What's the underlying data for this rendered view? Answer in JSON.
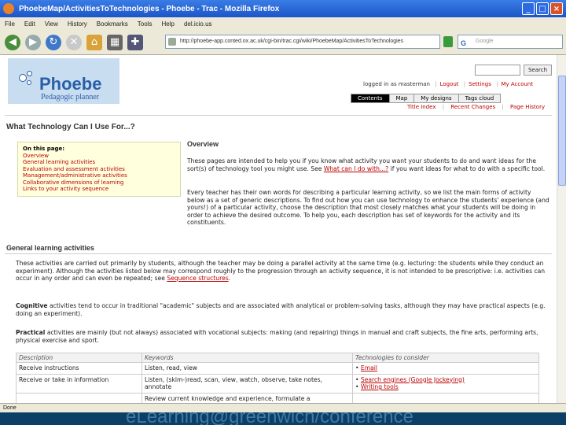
{
  "window": {
    "title": "PhoebeMap/ActivitiesToTechnologies - Phoebe - Trac - Mozilla Firefox"
  },
  "menu": [
    "File",
    "Edit",
    "View",
    "History",
    "Bookmarks",
    "Tools",
    "Help",
    "del.icio.us"
  ],
  "toolbar": {
    "url": "http://phoebe-app.conted.ox.ac.uk/cgi-bin/trac.cgi/wiki/PhoebeMap/ActivitiesToTechnologies",
    "search_placeholder": "Google",
    "search_engine_glyph": "G"
  },
  "site": {
    "logo_name": "Phoebe",
    "logo_sub": "Pedagogic planner",
    "search_button": "Search",
    "logged_in": "logged in as masterman",
    "logout": "Logout",
    "settings": "Settings",
    "my_account": "My Account",
    "nav": [
      "Contents",
      "Map",
      "My designs",
      "Tags cloud"
    ],
    "ctx_nav": [
      "Title Index",
      "Recent Changes",
      "Page History"
    ]
  },
  "page": {
    "title": "What Technology Can I Use For...?",
    "toc": {
      "heading": "On this page:",
      "items": [
        "Overview",
        "General learning activities",
        "Evaluation and assessment activities",
        "Management/administrative activities",
        "Collaborative dimensions of learning",
        "Links to your activity sequence"
      ]
    },
    "overview_heading": "Overview",
    "overview_p1_a": "These pages are intended to help you if you know what activity you want your students to do and want ideas for the sort(s) of technology tool you might use. See ",
    "overview_p1_link": "What can I do with...?",
    "overview_p1_b": " if you want ideas for what to do with a specific tool.",
    "overview_p2": "Every teacher has their own words for describing a particular learning activity, so we list the main forms of activity below as a set of generic descriptions. To find out how you can use technology to enhance the students' experience (and yours!) of a particular activity, choose the description that most closely matches what your students will be doing in order to achieve the desired outcome. To help you, each description has set of keywords for the activity and its constituents.",
    "general_heading": "General learning activities",
    "general_p1_a": "These activities are carried out primarily by students, although the teacher may be doing a parallel activity at the same time (e.g. lecturing: the students while they conduct an experiment). Although the activities listed below may correspond roughly to the progression through an activity sequence, it is not intended to be prescriptive: i.e. activities can occur in any order and can even be repeated; see ",
    "general_p1_link": "Sequence structures",
    "general_p1_b": ".",
    "cognitive_term": "Cognitive",
    "cognitive_text": " activities tend to occur in traditional \"academic\" subjects and are associated with analytical or problem-solving tasks, although they may have practical aspects (e.g. doing an experiment).",
    "practical_term": "Practical",
    "practical_text": " activities are mainly (but not always) associated with vocational subjects: making (and repairing) things in manual and craft subjects, the fine arts, performing arts, physical exercise and sport."
  },
  "table": {
    "headers": [
      "Description",
      "Keywords",
      "Technologies to consider"
    ],
    "rows": [
      {
        "description": "Receive instructions",
        "keywords": "Listen, read, view",
        "tech": [
          "Email"
        ]
      },
      {
        "description": "Receive or take in information",
        "keywords": "Listen, (skim-)read, scan, view, watch, observe, take notes, annotate",
        "tech": [
          "Search engines (Google Jockeying)",
          "Writing tools"
        ]
      },
      {
        "description": "",
        "keywords": "Review current knowledge and experience, formulate a",
        "tech": []
      }
    ]
  },
  "status": {
    "text": "Done"
  },
  "footer": {
    "text": "eLearning@greenwich/conference"
  }
}
